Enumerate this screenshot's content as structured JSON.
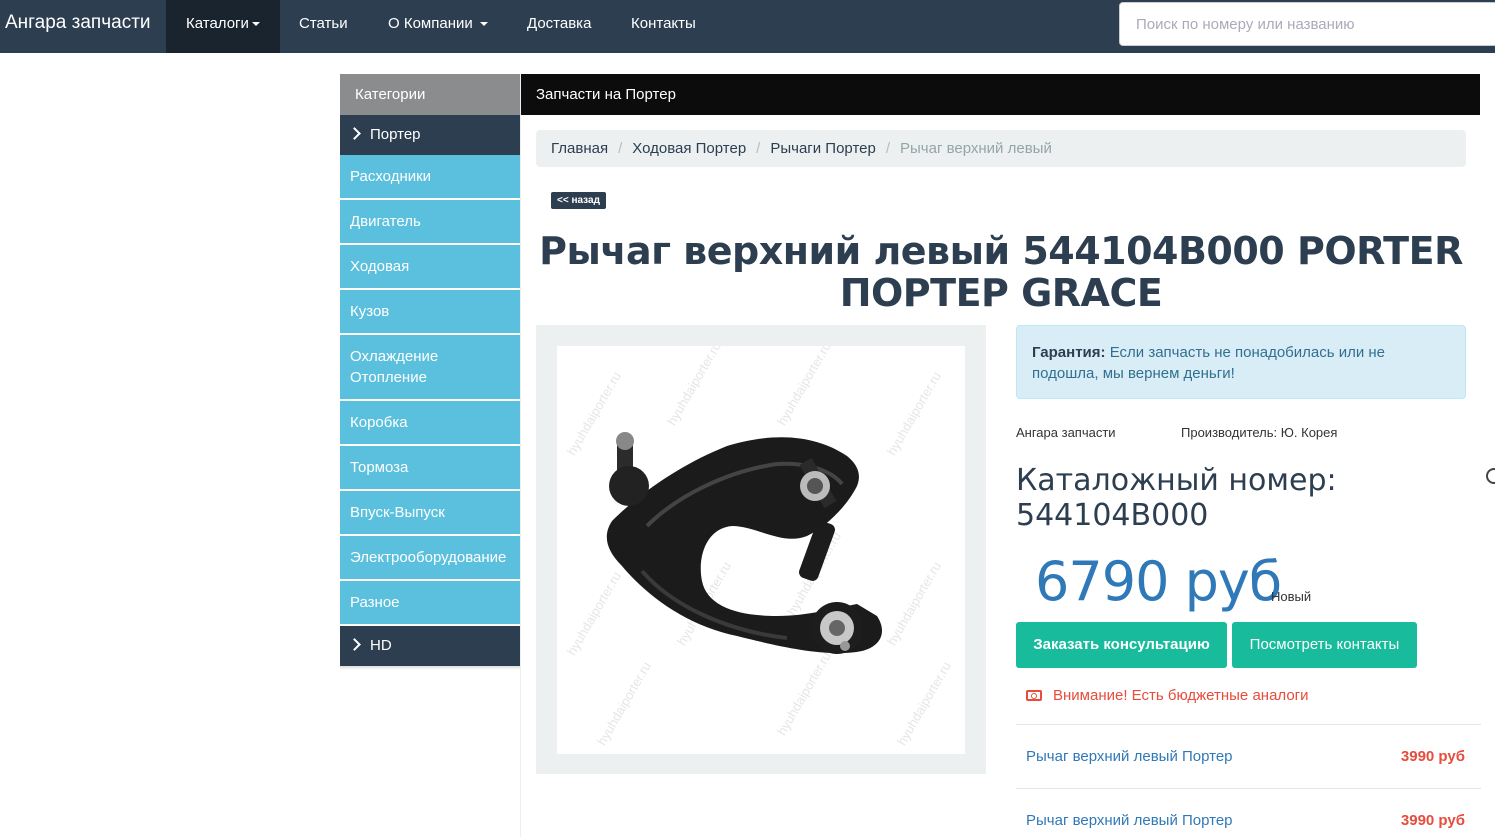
{
  "navbar": {
    "brand": "Ангара запчасти",
    "items": [
      {
        "label": "Каталоги"
      },
      {
        "label": "Статьи"
      },
      {
        "label": "О Компании"
      },
      {
        "label": "Доставка"
      },
      {
        "label": "Контакты"
      }
    ],
    "search_placeholder": "Поиск по номеру или названию"
  },
  "sidebar": {
    "header": "Категории",
    "parent_top": "Портер",
    "items": [
      {
        "label": "Расходники"
      },
      {
        "label": "Двигатель"
      },
      {
        "label": "Ходовая"
      },
      {
        "label": "Кузов"
      },
      {
        "label": "Охлаждение Отопление"
      },
      {
        "label": "Коробка"
      },
      {
        "label": "Тормоза"
      },
      {
        "label": "Впуск-Выпуск"
      },
      {
        "label": "Электрооборудование"
      },
      {
        "label": "Разное"
      }
    ],
    "parent_bottom": "HD"
  },
  "main": {
    "header": "Запчасти на Портер",
    "breadcrumb": [
      "Главная",
      "Ходовая Портер",
      "Рычаги Портер",
      "Рычаг верхний левый"
    ],
    "back_label": "<< назад",
    "title": "Рычаг верхний левый 544104B000 PORTER ПОРТЕР GRACE",
    "image_watermark": "hyuhdaiporter.ru",
    "alert_bold": "Гарантия:",
    "alert_text": "Если запчасть не понадобилась или не подошла, мы вернем деньги!",
    "seller": "Ангара запчасти",
    "manufacturer": "Производитель: Ю. Корея",
    "catalog_label": "Каталожный номер:",
    "catalog_number": "544104B000",
    "price": "6790 руб",
    "condition": "Новый",
    "btn_consult": "Заказать консультацию",
    "btn_contacts": "Посмотреть контакты",
    "warning": "Внимание! Есть бюджетные аналоги",
    "analogs": [
      {
        "name": "Рычаг верхний левый Портер",
        "price": "3990 руб"
      },
      {
        "name": "Рычаг верхний левый Портер",
        "price": "3990 руб"
      }
    ]
  },
  "colors": {
    "navbar_bg": "#2c3e50",
    "sidebar_item_bg": "#5bc0de",
    "accent_green": "#18bc9c",
    "price_blue": "#3079b8",
    "warning_red": "#e74c3c"
  }
}
